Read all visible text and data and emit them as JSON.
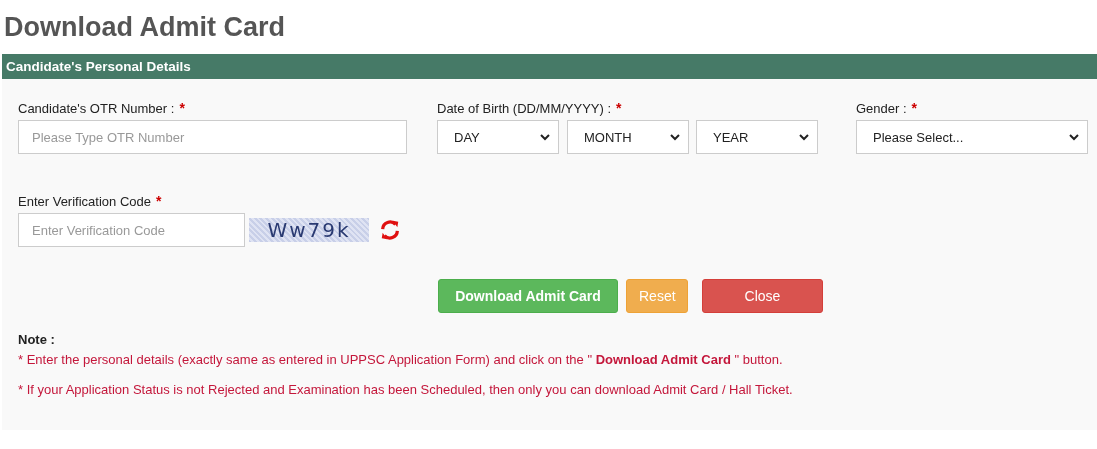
{
  "page_title": "Download Admit Card",
  "panel": {
    "title": "Candidate's Personal Details",
    "fields": [
      {
        "label": "Candidate's OTR Number :",
        "required_mark": "*",
        "kind": "text",
        "placeholder": "Please Type OTR Number"
      },
      {
        "label": "Date of Birth (DD/MM/YYYY) :",
        "required_mark": "*",
        "kind": "selects",
        "selects": [
          "DAY",
          "MONTH",
          "YEAR"
        ]
      },
      {
        "label": "Gender :",
        "required_mark": "*",
        "kind": "select",
        "selects": [
          "Please Select..."
        ]
      }
    ],
    "verification": {
      "label": "Enter Verification Code",
      "required_mark": "*",
      "placeholder": "Enter Verification Code",
      "captcha": "Ww79k"
    },
    "buttons": [
      {
        "label": "Download Admit Card",
        "kind": "success"
      },
      {
        "label": "Reset",
        "kind": "warning"
      },
      {
        "label": "Close",
        "kind": "danger"
      }
    ],
    "note_label": "Note :",
    "notes": [
      "* Enter the personal details (exactly same as entered in UPPSC Application Form) and click on the \" **Download Admit Card** \" button.",
      "* If your Application Status is not Rejected and Examination has been Scheduled, then only you can download Admit Card / Hall Ticket."
    ]
  }
}
